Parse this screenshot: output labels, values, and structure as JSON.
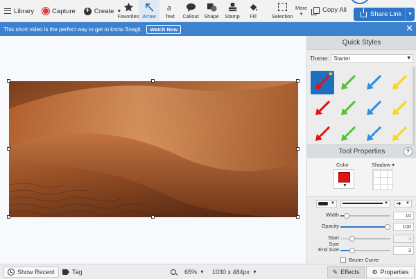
{
  "toolbar": {
    "library_label": "Library",
    "capture_label": "Capture",
    "create_label": "Create",
    "tools": [
      {
        "label": "Favorites",
        "icon": "star-icon"
      },
      {
        "label": "Arrow",
        "icon": "arrow-icon",
        "selected": true
      },
      {
        "label": "Text",
        "icon": "text-icon"
      },
      {
        "label": "Callout",
        "icon": "callout-icon"
      },
      {
        "label": "Shape",
        "icon": "shape-icon"
      },
      {
        "label": "Stamp",
        "icon": "stamp-icon"
      },
      {
        "label": "Fill",
        "icon": "fill-icon"
      }
    ],
    "selection_label": "Selection",
    "more_label": "More",
    "copy_all_label": "Copy All",
    "share_link_label": "Share Link"
  },
  "banner": {
    "text": "This short video is the perfect way to get to know Snagit.",
    "watch_label": "Watch Now"
  },
  "panel": {
    "quick_styles_title": "Quick Styles",
    "theme_label": "Theme:",
    "theme_value": "Starter",
    "tool_properties_title": "Tool Properties",
    "help_label": "?",
    "color_label": "Color",
    "color_value": "#e31212",
    "shadow_label": "Shadow",
    "sliders": [
      {
        "label": "Width",
        "value": "10",
        "fraction": 0.08,
        "disabled": false
      },
      {
        "label": "Opacity",
        "value": "100",
        "fraction": 1.0,
        "disabled": false
      },
      {
        "label": "Start Size",
        "value": "3",
        "fraction": 0.2,
        "disabled": true
      },
      {
        "label": "End Size",
        "value": "3",
        "fraction": 0.2,
        "disabled": false
      }
    ],
    "bezier_label": "Bezier Curve"
  },
  "statusbar": {
    "show_recent_label": "Show Recent",
    "tag_label": "Tag",
    "zoom_value": "65%",
    "dimensions_value": "1030 x 484px",
    "effects_label": "Effects",
    "properties_label": "Properties"
  },
  "colors": {
    "accent": "#2d75c9",
    "banner": "#3d82cf",
    "arrow_red": "#e31212",
    "arrow_green": "#56c23a",
    "arrow_blue": "#2f8fe0",
    "arrow_yellow": "#f5d81a"
  }
}
